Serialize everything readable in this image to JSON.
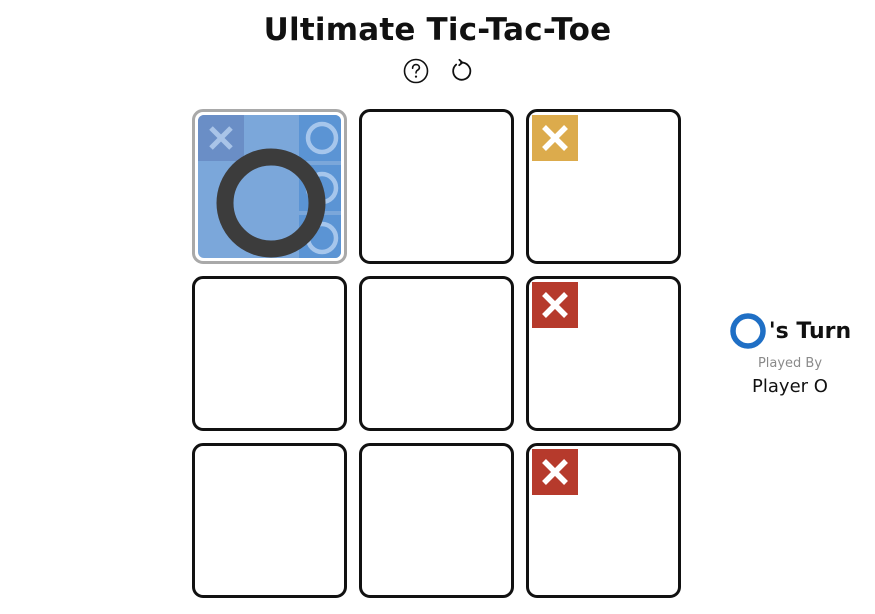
{
  "header": {
    "title": "Ultimate Tic-Tac-Toe",
    "help_icon": "question-circle-icon",
    "reset_icon": "restart-arrow-icon"
  },
  "colors": {
    "o_blue": "#1f6fc5",
    "won_o_background": "#7ba7da",
    "x_gold": "#dcab4c",
    "x_red": "#b63a2c",
    "big_o": "#3c3c3c"
  },
  "board": {
    "cells": [
      {
        "index": 0,
        "state": "won",
        "winner": "O",
        "marks": [
          {
            "mini": 0,
            "symbol": "X"
          },
          {
            "mini": 2,
            "symbol": "O"
          },
          {
            "mini": 5,
            "symbol": "O"
          },
          {
            "mini": 8,
            "symbol": "O"
          }
        ]
      },
      {
        "index": 1,
        "state": "empty",
        "marks": []
      },
      {
        "index": 2,
        "state": "active",
        "marks": [
          {
            "mini": 0,
            "symbol": "X",
            "color": "gold"
          }
        ]
      },
      {
        "index": 3,
        "state": "empty",
        "marks": []
      },
      {
        "index": 4,
        "state": "empty",
        "marks": []
      },
      {
        "index": 5,
        "state": "active",
        "marks": [
          {
            "mini": 0,
            "symbol": "X",
            "color": "red"
          }
        ]
      },
      {
        "index": 6,
        "state": "empty",
        "marks": []
      },
      {
        "index": 7,
        "state": "empty",
        "marks": []
      },
      {
        "index": 8,
        "state": "active",
        "marks": [
          {
            "mini": 0,
            "symbol": "X",
            "color": "red"
          }
        ]
      }
    ]
  },
  "status": {
    "current_symbol": "O",
    "turn_suffix": "'s Turn",
    "played_by_label": "Played By",
    "player_name": "Player O"
  }
}
